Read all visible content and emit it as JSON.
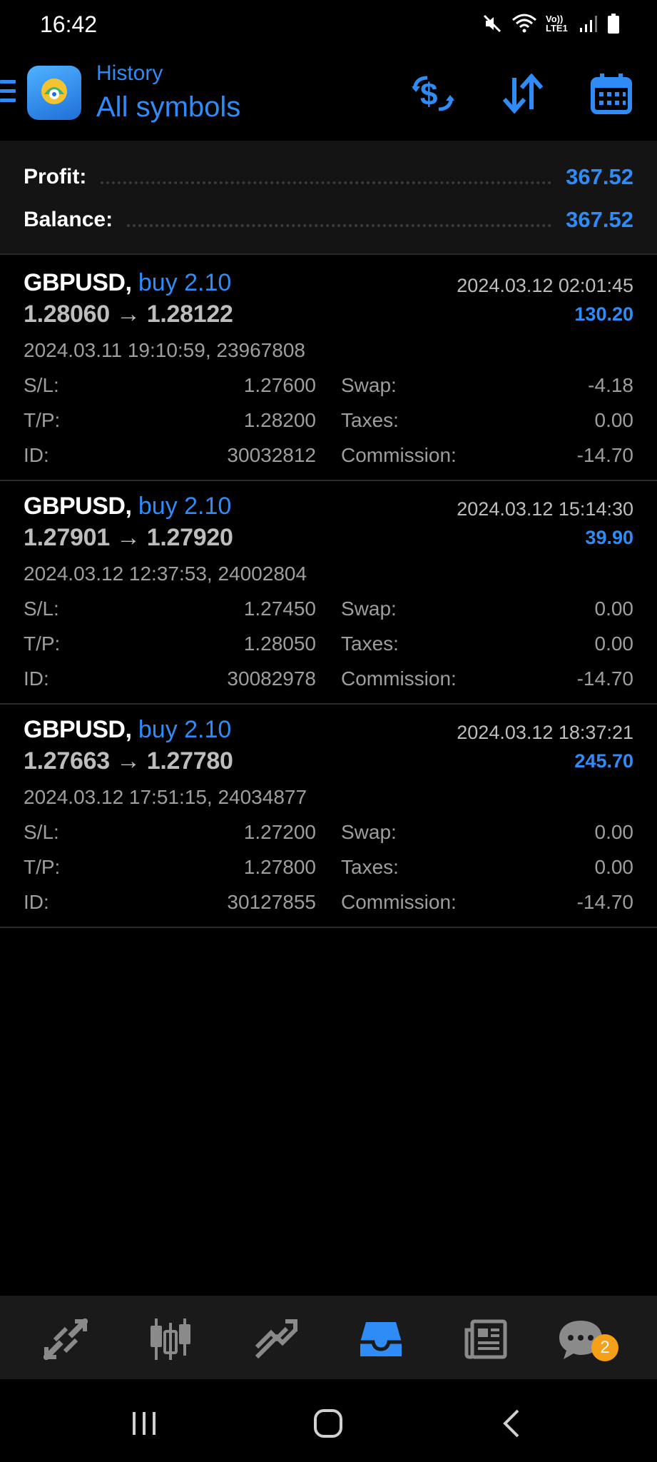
{
  "status_bar": {
    "time": "16:42",
    "network_label": "Vo)) LTE1"
  },
  "header": {
    "subtitle": "History",
    "title": "All symbols"
  },
  "summary": {
    "profit_label": "Profit:",
    "profit_value": "367.52",
    "balance_label": "Balance:",
    "balance_value": "367.52"
  },
  "deals": [
    {
      "symbol": "GBPUSD,",
      "type": "buy 2.10",
      "prices": "1.28060 → 1.28122",
      "close_time": "2024.03.12 02:01:45",
      "profit": "130.20",
      "open_info": "2024.03.11 19:10:59, 23967808",
      "sl_label": "S/L:",
      "sl": "1.27600",
      "swap_label": "Swap:",
      "swap": "-4.18",
      "tp_label": "T/P:",
      "tp": "1.28200",
      "taxes_label": "Taxes:",
      "taxes": "0.00",
      "id_label": "ID:",
      "id": "30032812",
      "commission_label": "Commission:",
      "commission": "-14.70"
    },
    {
      "symbol": "GBPUSD,",
      "type": "buy 2.10",
      "prices": "1.27901 → 1.27920",
      "close_time": "2024.03.12 15:14:30",
      "profit": "39.90",
      "open_info": "2024.03.12 12:37:53, 24002804",
      "sl_label": "S/L:",
      "sl": "1.27450",
      "swap_label": "Swap:",
      "swap": "0.00",
      "tp_label": "T/P:",
      "tp": "1.28050",
      "taxes_label": "Taxes:",
      "taxes": "0.00",
      "id_label": "ID:",
      "id": "30082978",
      "commission_label": "Commission:",
      "commission": "-14.70"
    },
    {
      "symbol": "GBPUSD,",
      "type": "buy 2.10",
      "prices": "1.27663 → 1.27780",
      "close_time": "2024.03.12 18:37:21",
      "profit": "245.70",
      "open_info": "2024.03.12 17:51:15, 24034877",
      "sl_label": "S/L:",
      "sl": "1.27200",
      "swap_label": "Swap:",
      "swap": "0.00",
      "tp_label": "T/P:",
      "tp": "1.27800",
      "taxes_label": "Taxes:",
      "taxes": "0.00",
      "id_label": "ID:",
      "id": "30127855",
      "commission_label": "Commission:",
      "commission": "-14.70"
    }
  ],
  "tabbar": {
    "items": [
      {
        "icon": "quotes-icon",
        "active": false
      },
      {
        "icon": "chart-icon",
        "active": false
      },
      {
        "icon": "trade-icon",
        "active": false
      },
      {
        "icon": "history-icon",
        "active": true
      },
      {
        "icon": "news-icon",
        "active": false
      },
      {
        "icon": "chat-icon",
        "active": false
      }
    ],
    "chat_badge": "2"
  },
  "colors": {
    "accent": "#2f8cf7",
    "badge": "#f6a01a",
    "background": "#000000",
    "summary_bg": "#141414",
    "tabbar_bg": "#1a1a1a"
  }
}
